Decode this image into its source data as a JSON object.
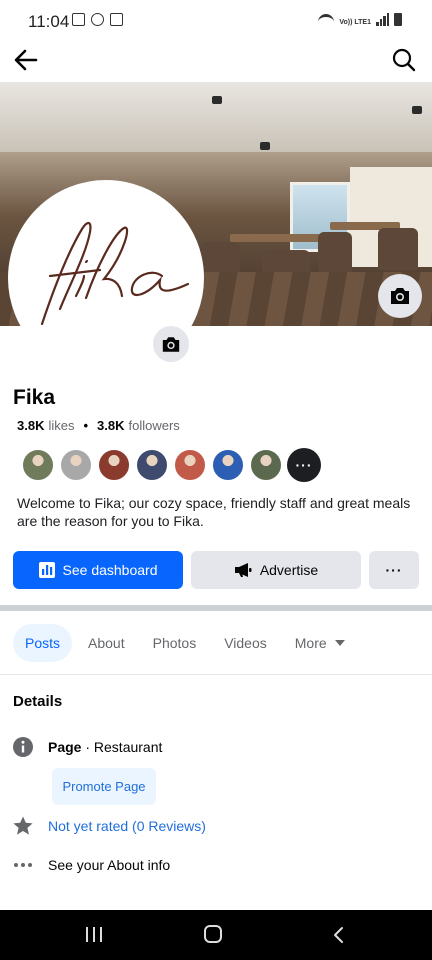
{
  "status_bar": {
    "time": "11:04",
    "network_label": "Vo)) LTE1",
    "icons": [
      "gallery-icon",
      "accessibility-icon",
      "lock-icon",
      "wifi-icon",
      "signal-icon",
      "battery-icon"
    ]
  },
  "header": {
    "back_icon": "arrow-left-icon",
    "search_icon": "search-icon"
  },
  "profile": {
    "logo_text": "fika",
    "name": "Fika",
    "likes_count": "3.8K",
    "likes_label": "likes",
    "followers_count": "3.8K",
    "followers_label": "followers",
    "bio": "Welcome to Fika; our cozy space, friendly staff and great meals are the reason for you to Fika.",
    "follower_avatar_colors": [
      "#6f7b5a",
      "#a8a8a8",
      "#8b3a2e",
      "#3e4a6e",
      "#c25a4a",
      "#2c5fb3",
      "#5b6a4f"
    ],
    "more_followers_glyph": "···"
  },
  "actions": {
    "dashboard_label": "See dashboard",
    "advertise_label": "Advertise",
    "more_glyph": "···"
  },
  "tabs": [
    {
      "label": "Posts",
      "active": true
    },
    {
      "label": "About",
      "active": false
    },
    {
      "label": "Photos",
      "active": false
    },
    {
      "label": "Videos",
      "active": false
    },
    {
      "label": "More",
      "active": false
    }
  ],
  "details": {
    "title": "Details",
    "category_prefix": "Page",
    "category_suffix": " · Restaurant",
    "promote_label": "Promote Page",
    "rating_label": "Not yet rated (0 Reviews)",
    "about_label": "See your About info"
  },
  "colors": {
    "brand_blue": "#0866ff",
    "link_blue": "#216fdb",
    "logo_brown": "#5a2a1f"
  }
}
